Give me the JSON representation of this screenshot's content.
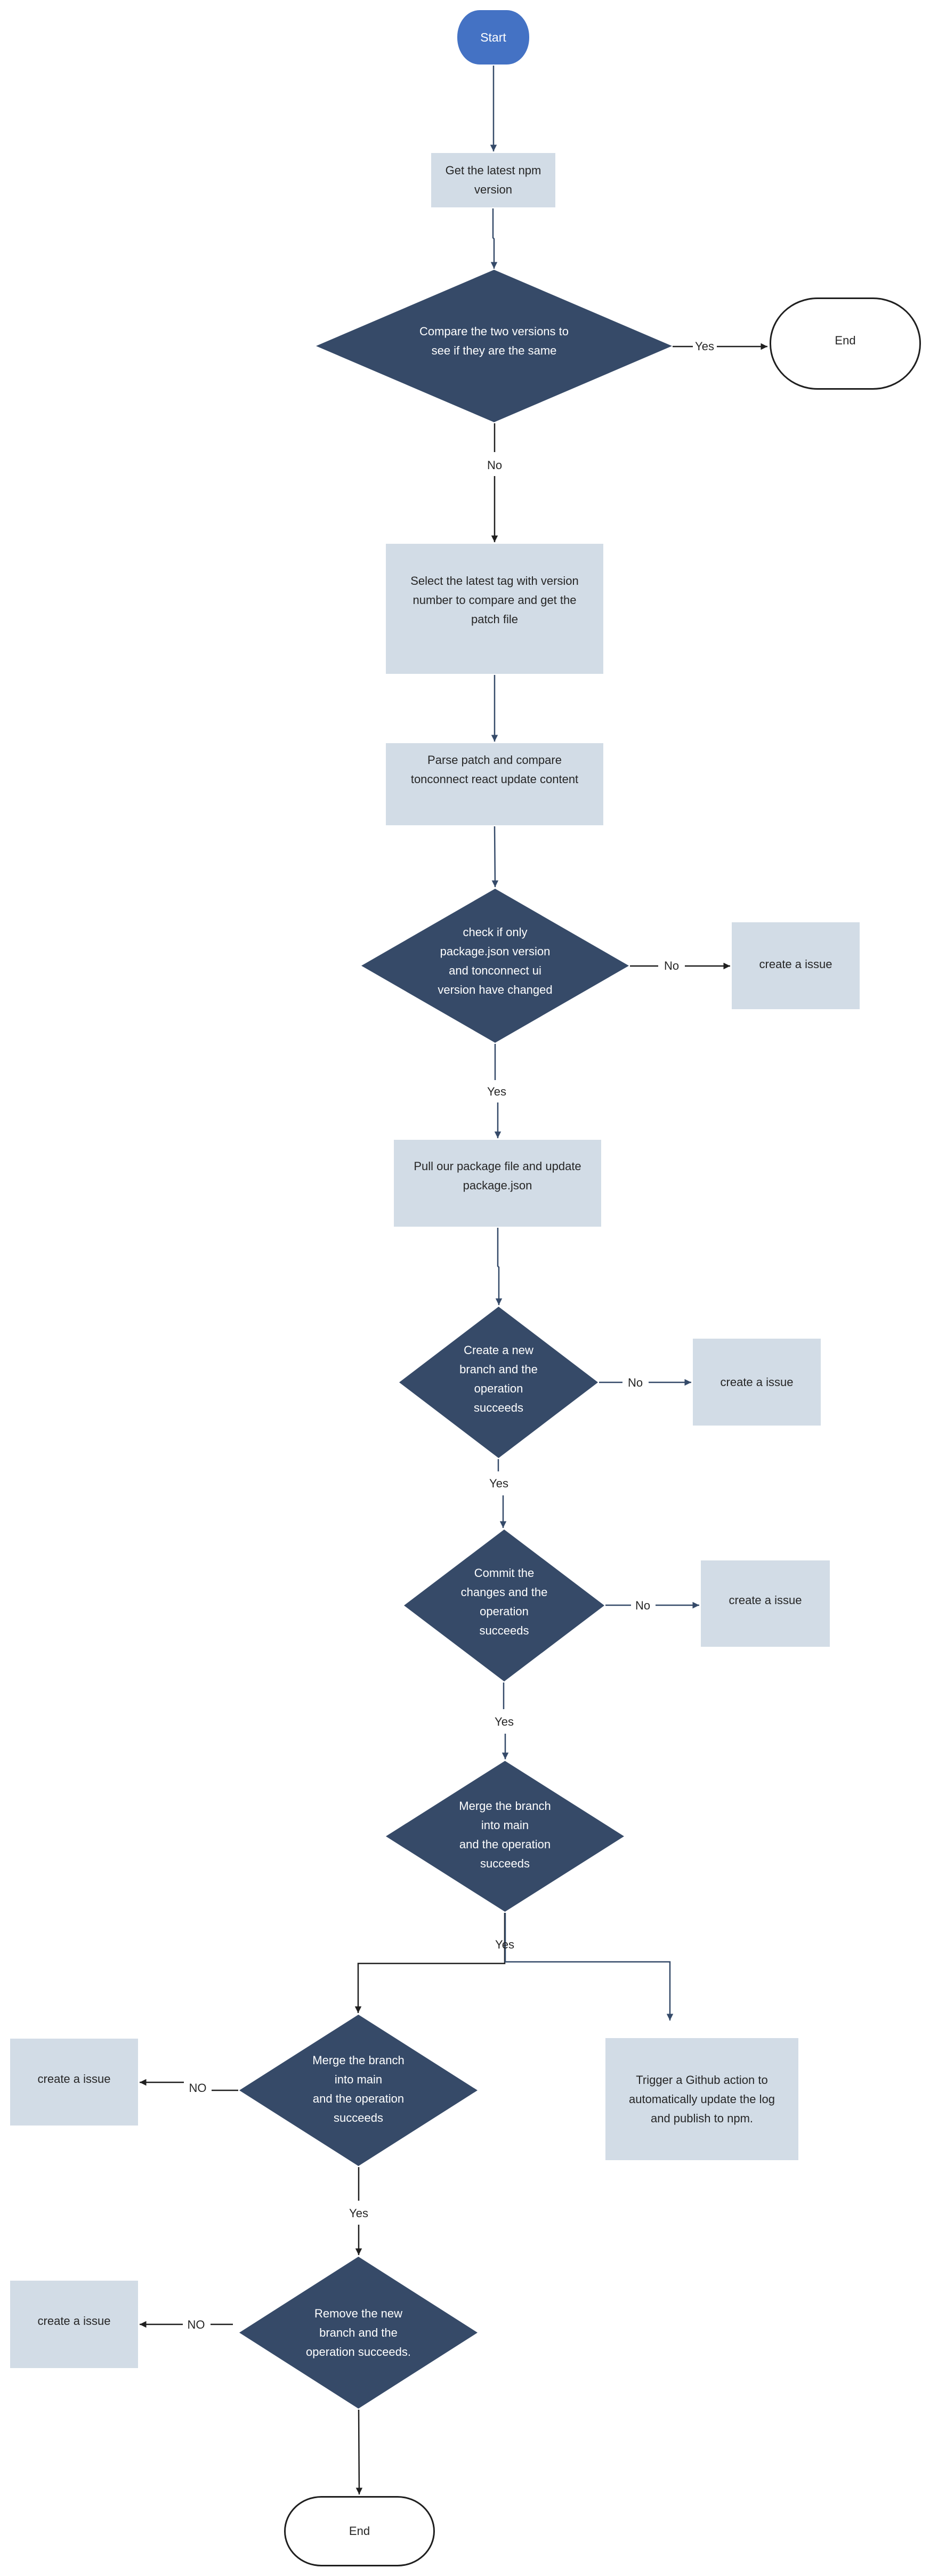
{
  "diagram": {
    "colors": {
      "start_fill": "#4472C4",
      "decision_fill": "#364A68",
      "process_fill": "#D2DCE6",
      "connector": "#354A69",
      "connector_dark": "#1F1F1F",
      "text_dark": "#262626",
      "text_light": "#FFFFFF"
    },
    "nodes": {
      "start": {
        "type": "terminal",
        "label": "Start"
      },
      "get_npm": {
        "type": "process",
        "label": "Get the latest npm\nversion"
      },
      "compare_versions": {
        "type": "decision",
        "label": "Compare the two versions to\nsee if they are the same"
      },
      "end_top": {
        "type": "terminal",
        "label": "End"
      },
      "select_tag": {
        "type": "process",
        "label": "Select the latest tag with version\nnumber to compare and get the\npatch file"
      },
      "parse_patch": {
        "type": "process",
        "label": "Parse patch and compare\ntonconnect react update content"
      },
      "check_changes": {
        "type": "decision",
        "label": "check if only\npackage.json version\nand tonconnect ui\nversion have changed"
      },
      "issue_1": {
        "type": "process",
        "label": "create a issue"
      },
      "pull_package": {
        "type": "process",
        "label": "Pull our package file and update\npackage.json"
      },
      "create_branch": {
        "type": "decision",
        "label": "Create a new\nbranch and the\noperation\nsucceeds"
      },
      "issue_2": {
        "type": "process",
        "label": "create a issue"
      },
      "commit_changes": {
        "type": "decision",
        "label": "Commit the\nchanges and the\noperation\nsucceeds"
      },
      "issue_3": {
        "type": "process",
        "label": "create a issue"
      },
      "merge_main_1": {
        "type": "decision",
        "label": "Merge the branch\ninto main\nand the operation\nsucceeds"
      },
      "merge_main_2": {
        "type": "decision",
        "label": "Merge the branch\ninto main\nand the operation\nsucceeds"
      },
      "issue_4": {
        "type": "process",
        "label": "create a issue"
      },
      "trigger_action": {
        "type": "process",
        "label": "Trigger a Github action to\nautomatically update the log\nand publish to npm."
      },
      "remove_branch": {
        "type": "decision",
        "label": "Remove the new\nbranch and the\noperation succeeds."
      },
      "issue_5": {
        "type": "process",
        "label": "create a issue"
      },
      "end_bottom": {
        "type": "terminal",
        "label": "End"
      }
    },
    "edges": [
      {
        "from": "start",
        "to": "get_npm",
        "label": ""
      },
      {
        "from": "get_npm",
        "to": "compare_versions",
        "label": ""
      },
      {
        "from": "compare_versions",
        "to": "end_top",
        "label": "Yes"
      },
      {
        "from": "compare_versions",
        "to": "select_tag",
        "label": "No"
      },
      {
        "from": "select_tag",
        "to": "parse_patch",
        "label": ""
      },
      {
        "from": "parse_patch",
        "to": "check_changes",
        "label": ""
      },
      {
        "from": "check_changes",
        "to": "issue_1",
        "label": "No"
      },
      {
        "from": "check_changes",
        "to": "pull_package",
        "label": "Yes"
      },
      {
        "from": "pull_package",
        "to": "create_branch",
        "label": ""
      },
      {
        "from": "create_branch",
        "to": "issue_2",
        "label": "No"
      },
      {
        "from": "create_branch",
        "to": "commit_changes",
        "label": "Yes"
      },
      {
        "from": "commit_changes",
        "to": "issue_3",
        "label": "No"
      },
      {
        "from": "commit_changes",
        "to": "merge_main_1",
        "label": "Yes"
      },
      {
        "from": "merge_main_1",
        "to": "merge_main_2",
        "label": "Yes"
      },
      {
        "from": "merge_main_1",
        "to": "trigger_action",
        "label": ""
      },
      {
        "from": "merge_main_2",
        "to": "issue_4",
        "label": "NO"
      },
      {
        "from": "merge_main_2",
        "to": "remove_branch",
        "label": "Yes"
      },
      {
        "from": "remove_branch",
        "to": "issue_5",
        "label": "NO"
      },
      {
        "from": "remove_branch",
        "to": "end_bottom",
        "label": ""
      }
    ]
  }
}
